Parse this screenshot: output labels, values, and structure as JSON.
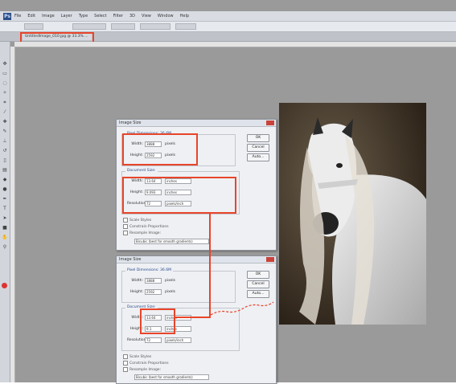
{
  "app": {
    "logo": "Ps",
    "menu": [
      "File",
      "Edit",
      "Image",
      "Layer",
      "Type",
      "Select",
      "Filter",
      "3D",
      "View",
      "Window",
      "Help"
    ]
  },
  "document_tab": {
    "label": "UntitledImage_010.jpg @ 33.3% ..."
  },
  "colors": {
    "highlight": "#e8452a",
    "workspace": "#9a9a9a",
    "dialog_bg": "#eef0f4"
  },
  "dialog_top": {
    "title": "Image Size",
    "pixel_group": "Pixel Dimensions: 36.6M",
    "width_label": "Width:",
    "width_value": "3888",
    "width_unit": "pixels",
    "height_label": "Height:",
    "height_value": "2592",
    "height_unit": "pixels",
    "doc_group": "Document Size:",
    "doc_width_label": "Width:",
    "doc_width_value": "13.64",
    "doc_width_unit": "inches",
    "doc_height_label": "Height:",
    "doc_height_value": "9.093",
    "doc_height_unit": "inches",
    "res_label": "Resolution:",
    "res_value": "72",
    "res_unit": "pixels/inch",
    "scale_styles": "Scale Styles",
    "constrain": "Constrain Proportions",
    "resample": "Resample Image:",
    "resample_method": "Bicubic (best for smooth gradients)",
    "ok": "OK",
    "cancel": "Cancel",
    "auto": "Auto..."
  },
  "dialog_bottom": {
    "title": "Image Size",
    "pixel_group": "Pixel Dimensions: 36.6M",
    "width_label": "Width:",
    "width_value": "3888",
    "width_unit": "pixels",
    "height_label": "Height:",
    "height_value": "2592",
    "height_unit": "pixels",
    "doc_group": "Document Size:",
    "doc_width_label": "Width:",
    "doc_width_value": "13.64",
    "doc_width_unit": "inches",
    "doc_height_label": "Height:",
    "doc_height_value": "9.1",
    "doc_height_unit": "inches",
    "res_label": "Resolution:",
    "res_value": "72",
    "res_unit": "pixels/inch",
    "scale_styles": "Scale Styles",
    "constrain": "Constrain Proportions",
    "resample": "Resample Image:",
    "resample_method": "Bicubic (best for smooth gradients)",
    "ok": "OK",
    "cancel": "Cancel",
    "auto": "Auto..."
  }
}
